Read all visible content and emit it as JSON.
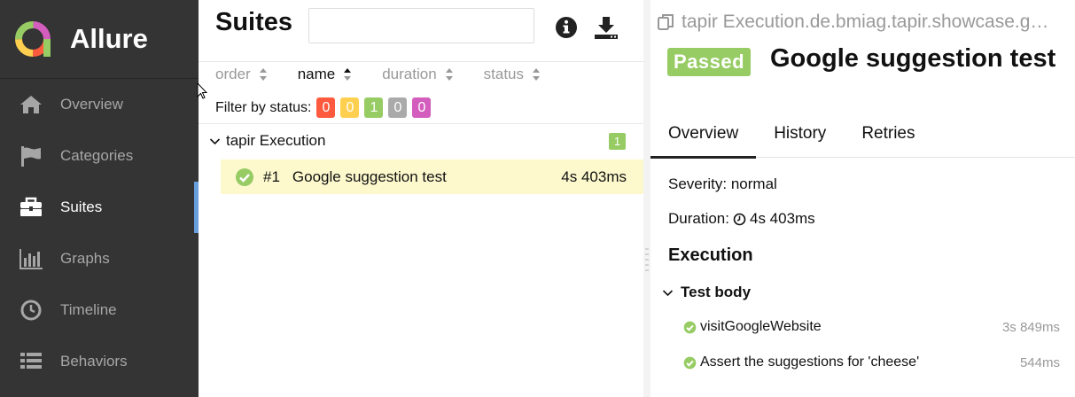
{
  "app": {
    "name": "Allure"
  },
  "sidebar": {
    "items": [
      {
        "label": "Overview",
        "icon": "home-icon",
        "active": false
      },
      {
        "label": "Categories",
        "icon": "flag-icon",
        "active": false
      },
      {
        "label": "Suites",
        "icon": "briefcase-icon",
        "active": true
      },
      {
        "label": "Graphs",
        "icon": "bar-chart-icon",
        "active": false
      },
      {
        "label": "Timeline",
        "icon": "clock-icon",
        "active": false
      },
      {
        "label": "Behaviors",
        "icon": "list-icon",
        "active": false
      }
    ]
  },
  "suites": {
    "title": "Suites",
    "search": {
      "value": "",
      "placeholder": ""
    },
    "info_icon": "info-icon",
    "download_icon": "download-icon",
    "sort": [
      {
        "label": "order",
        "current": false
      },
      {
        "label": "name",
        "current": true
      },
      {
        "label": "duration",
        "current": false
      },
      {
        "label": "status",
        "current": false
      }
    ],
    "filter": {
      "label": "Filter by status:",
      "statuses": [
        {
          "name": "failed",
          "count": "0",
          "color": "#fd5a3e"
        },
        {
          "name": "broken",
          "count": "0",
          "color": "#ffd050"
        },
        {
          "name": "passed",
          "count": "1",
          "color": "#97cc64"
        },
        {
          "name": "skipped",
          "count": "0",
          "color": "#aaaaaa"
        },
        {
          "name": "unknown",
          "count": "0",
          "color": "#d35ebe"
        }
      ]
    },
    "group": {
      "name": "tapir Execution",
      "count": "1"
    },
    "tests": [
      {
        "num": "#1",
        "name": "Google suggestion test",
        "duration": "4s 403ms",
        "status": "passed"
      }
    ]
  },
  "details": {
    "breadcrumb": "tapir Execution.de.bmiag.tapir.showcase.g…",
    "status": "Passed",
    "title": "Google suggestion test",
    "tabs": [
      {
        "label": "Overview",
        "active": true
      },
      {
        "label": "History",
        "active": false
      },
      {
        "label": "Retries",
        "active": false
      }
    ],
    "severity_label": "Severity: normal",
    "duration_prefix": "Duration:",
    "duration_value": "4s 403ms",
    "section": "Execution",
    "step_group": "Test body",
    "steps": [
      {
        "name": "visitGoogleWebsite",
        "duration": "3s 849ms"
      },
      {
        "name": "Assert the suggestions for 'cheese'",
        "duration": "544ms"
      }
    ]
  },
  "colors": {
    "sidebar_bg": "#343434",
    "active_accent": "#679edb",
    "passed": "#97cc64",
    "selected_row": "#fdf9cd"
  }
}
